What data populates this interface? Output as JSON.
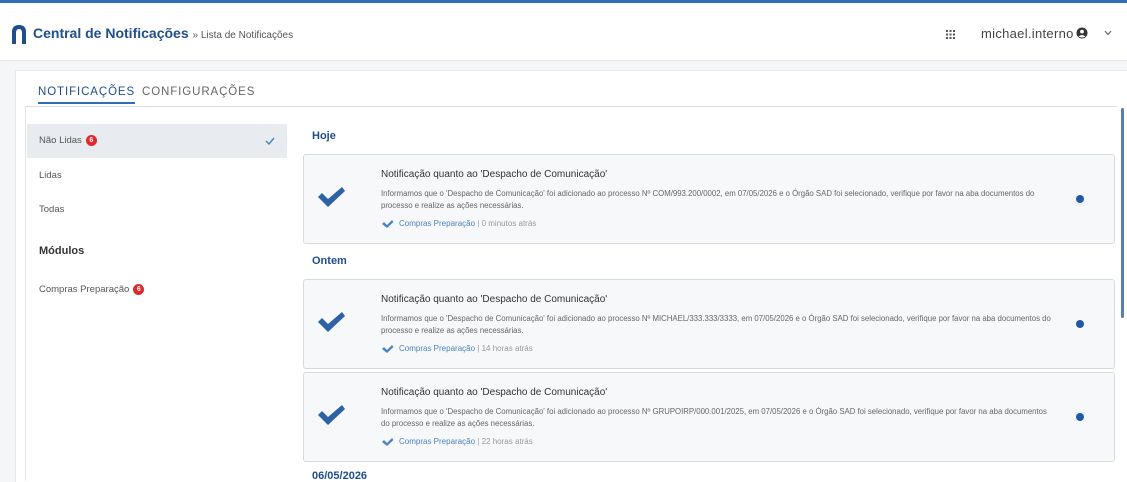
{
  "header": {
    "app_title": "Central de Notificações",
    "breadcrumb": "» Lista de Notificações",
    "username": "michael.interno",
    "grid_icon": "apps-grid-icon",
    "user_icon": "user-circle-icon"
  },
  "tabs": [
    {
      "label": "NOTIFICAÇÕES",
      "active": true
    },
    {
      "label": "CONFIGURAÇÕES",
      "active": false
    }
  ],
  "sidebar": {
    "filters": [
      {
        "label": "Não Lidas",
        "badge": "6",
        "selected": true
      },
      {
        "label": "Lidas"
      },
      {
        "label": "Todas"
      }
    ],
    "modules_heading": "Módulos",
    "modules": [
      {
        "label": "Compras Preparação",
        "badge": "6"
      }
    ]
  },
  "groups": [
    {
      "date": "Hoje"
    },
    {
      "date": "Ontem"
    },
    {
      "date": "06/05/2026"
    }
  ],
  "notifications": [
    {
      "title": "Notificação quanto ao 'Despacho de Comunicação'",
      "body": "Informamos que o 'Despacho de Comunicação' foi adicionado ao processo Nº COM/993.200/0002, em 07/05/2026 e o Órgão SAD foi selecionado, verifique por favor na aba documentos do processo e realize as ações necessárias.",
      "module": "Compras Preparação",
      "time": "| 0 minutos atrás"
    },
    {
      "title": "Notificação quanto ao 'Despacho de Comunicação'",
      "body": "Informamos que o 'Despacho de Comunicação' foi adicionado ao processo Nº MICHAEL/333.333/3333, em 07/05/2026 e o Órgão SAD foi selecionado, verifique por favor na aba documentos do processo e realize as ações necessárias.",
      "module": "Compras Preparação",
      "time": "| 14 horas atrás"
    },
    {
      "title": "Notificação quanto ao 'Despacho de Comunicação'",
      "body": "Informamos que o 'Despacho de Comunicação' foi adicionado ao processo Nº GRUPOIRP/000.001/2025, em 07/05/2026 e o Órgão SAD foi selecionado, verifique por favor na aba documentos do processo e realize as ações necessárias.",
      "module": "Compras Preparação",
      "time": "| 22 horas atrás"
    }
  ],
  "colors": {
    "accent": "#2c6fb7",
    "title_blue": "#1f4e8c",
    "badge_red": "#e02a2a",
    "unread_dot": "#1f5aa6"
  }
}
